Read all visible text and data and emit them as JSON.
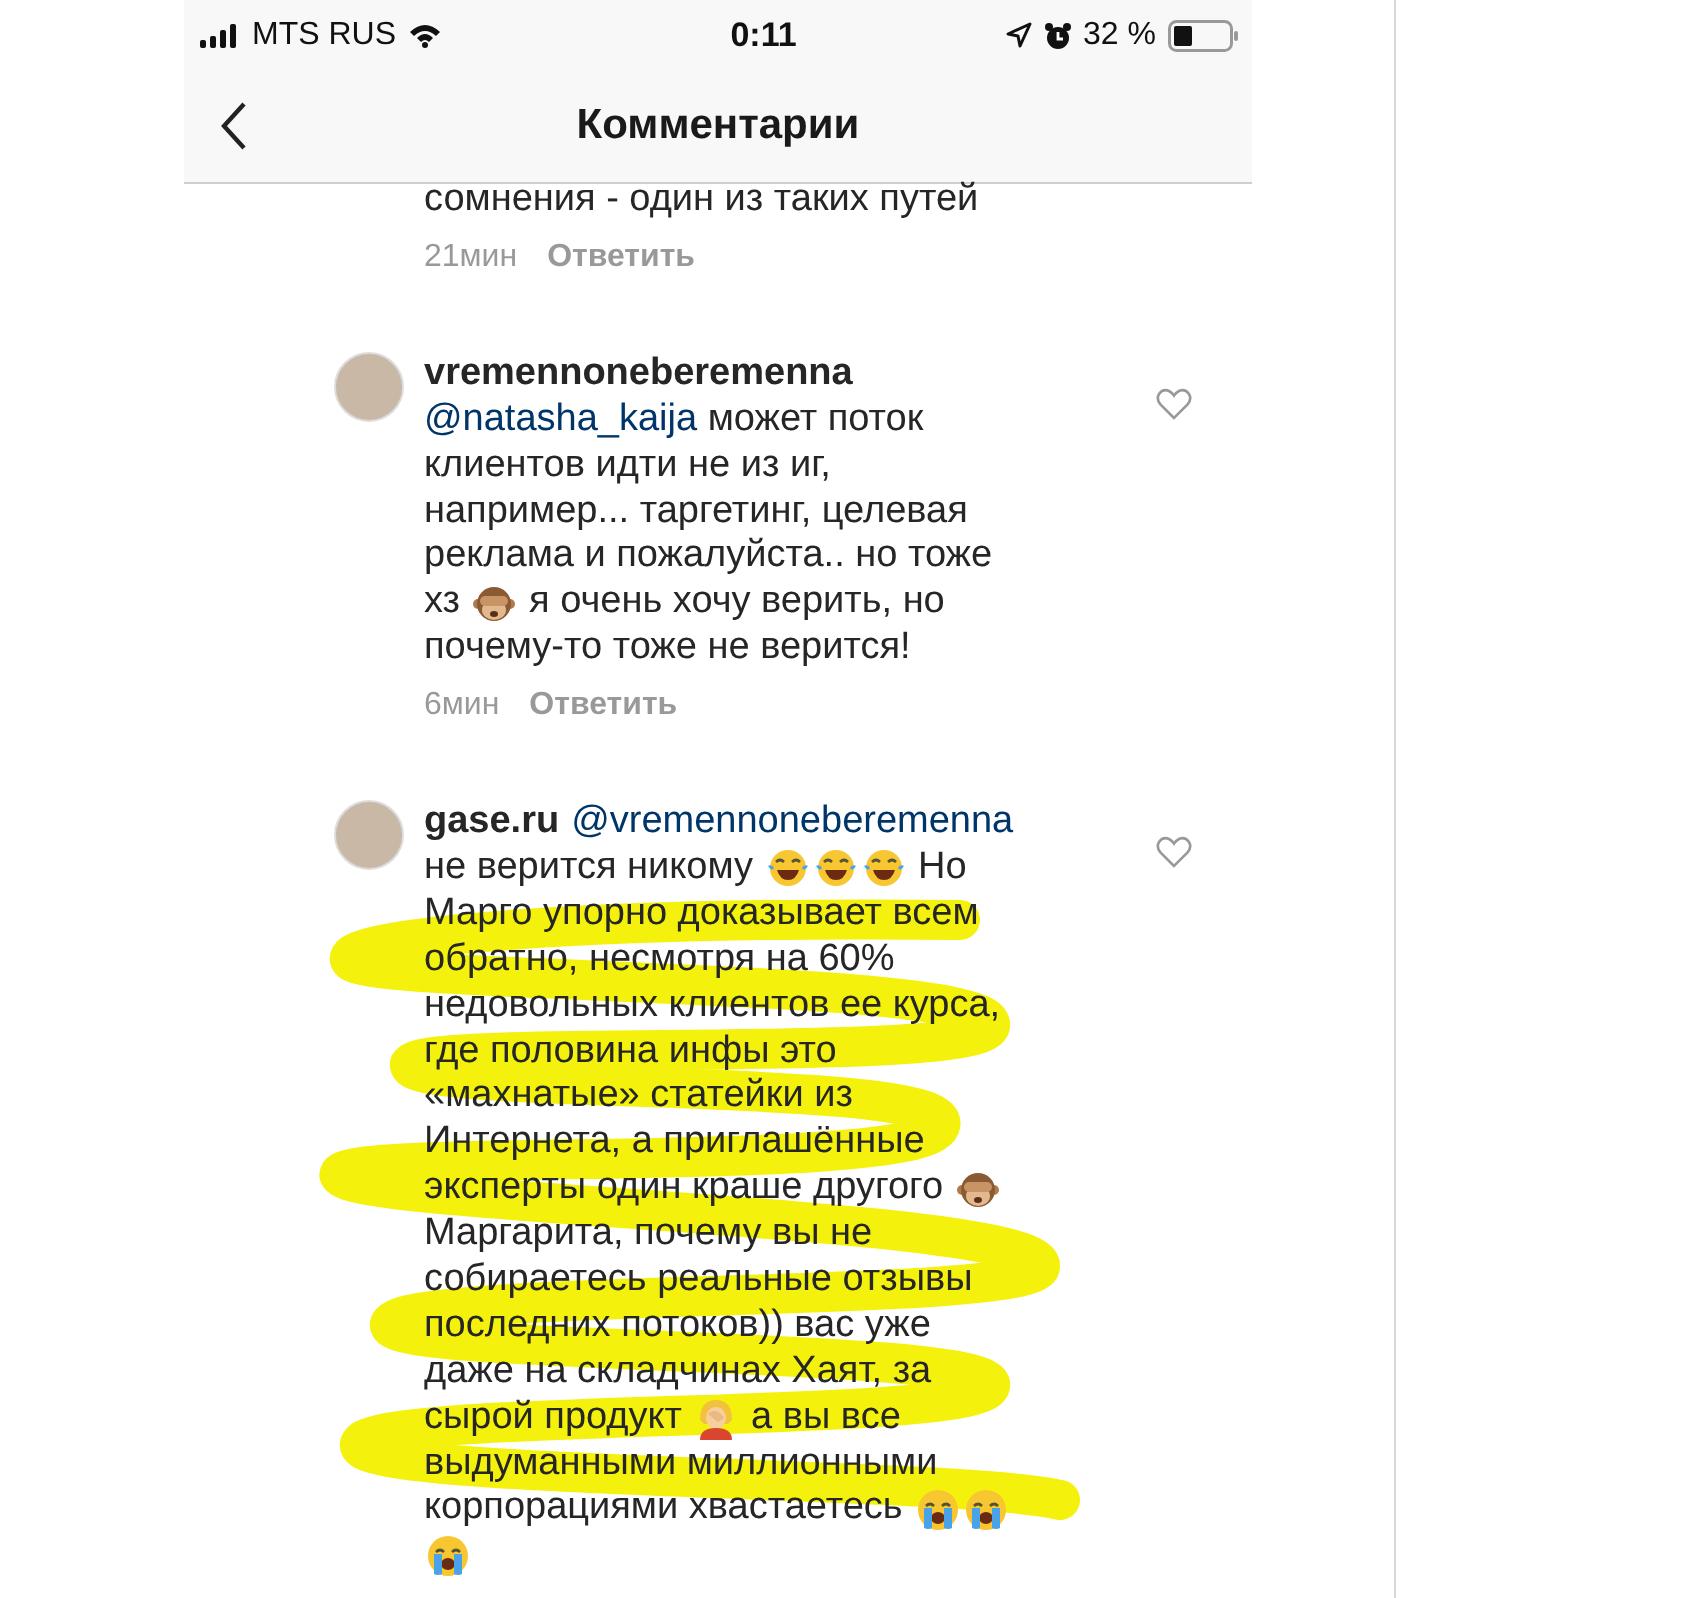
{
  "status_bar": {
    "carrier": "MTS RUS",
    "time": "0:11",
    "battery": "32 %"
  },
  "nav": {
    "title": "Комментарии"
  },
  "comments": [
    {
      "lines": [
        [
          {
            "kind": "text",
            "text": "сомнения - один из таких путей"
          }
        ]
      ],
      "time": "21мин",
      "reply": "Ответить"
    },
    {
      "avatar": true,
      "liked": false,
      "highlighted": false,
      "lines": [
        [
          {
            "kind": "username",
            "text": "vremennoneberemenna"
          }
        ],
        [
          {
            "kind": "mention",
            "text": "@natasha_kaija"
          },
          {
            "kind": "text",
            "text": " может поток"
          }
        ],
        [
          {
            "kind": "text",
            "text": "клиентов идти не из иг,"
          }
        ],
        [
          {
            "kind": "text",
            "text": "например... таргетинг, целевая"
          }
        ],
        [
          {
            "kind": "text",
            "text": "реклама и пожалуйста.. но тоже"
          }
        ],
        [
          {
            "kind": "text",
            "text": "хз "
          },
          {
            "kind": "monkey"
          },
          {
            "kind": "text",
            "text": " я очень хочу верить, но"
          }
        ],
        [
          {
            "kind": "text",
            "text": "почему-то тоже не верится!"
          }
        ]
      ],
      "time": "6мин",
      "reply": "Ответить"
    },
    {
      "avatar": true,
      "liked": false,
      "highlighted": true,
      "lines": [
        [
          {
            "kind": "username",
            "text": "gase.ru"
          },
          {
            "kind": "mention",
            "text": "@vremennoneberemenna"
          }
        ],
        [
          {
            "kind": "text",
            "text": "не верится никому "
          },
          {
            "kind": "laughing"
          },
          {
            "kind": "laughing"
          },
          {
            "kind": "laughing"
          },
          {
            "kind": "text",
            "text": " Но"
          }
        ],
        [
          {
            "kind": "text",
            "text": "Марго упорно доказывает всем"
          }
        ],
        [
          {
            "kind": "text",
            "text": "обратно, несмотря на 60%"
          }
        ],
        [
          {
            "kind": "text",
            "text": "недовольных клиентов ее курса,"
          }
        ],
        [
          {
            "kind": "text",
            "text": "где половина инфы это"
          }
        ],
        [
          {
            "kind": "text",
            "text": "«махнатые» статейки из"
          }
        ],
        [
          {
            "kind": "text",
            "text": "Интернета, а приглашённые"
          }
        ],
        [
          {
            "kind": "text",
            "text": "эксперты один краше другого "
          },
          {
            "kind": "monkey"
          }
        ],
        [
          {
            "kind": "text",
            "text": "Маргарита, почему вы не"
          }
        ],
        [
          {
            "kind": "text",
            "text": "собираетесь реальные отзывы"
          }
        ],
        [
          {
            "kind": "text",
            "text": "последних потоков)) вас уже"
          }
        ],
        [
          {
            "kind": "text",
            "text": "даже на складчинах Хаят, за"
          }
        ],
        [
          {
            "kind": "text",
            "text": "сырой продукт "
          },
          {
            "kind": "facepalm"
          },
          {
            "kind": "text",
            "text": " а вы все"
          }
        ],
        [
          {
            "kind": "text",
            "text": "выдуманными миллионными"
          }
        ],
        [
          {
            "kind": "text",
            "text": "корпорациями хвастаетесь "
          },
          {
            "kind": "crying"
          },
          {
            "kind": "crying"
          }
        ],
        [
          {
            "kind": "crying"
          }
        ]
      ]
    }
  ]
}
